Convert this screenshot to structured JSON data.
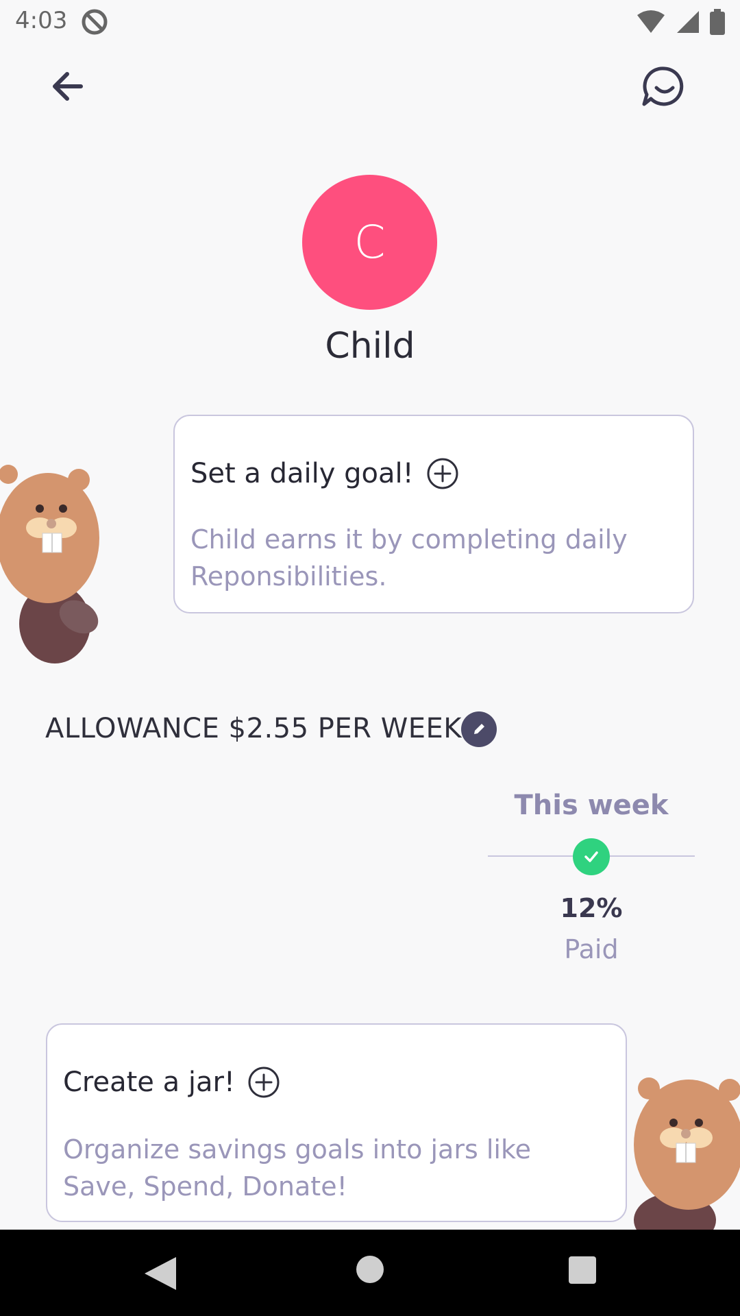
{
  "status_bar": {
    "time": "4:03"
  },
  "profile": {
    "initial": "C",
    "name": "Child",
    "avatar_color": "#fe4f7e"
  },
  "goal_card": {
    "title": "Set a daily goal!",
    "description": "Child earns it by completing daily Reponsibilities."
  },
  "allowance": {
    "label": "ALLOWANCE $2.55 PER WEEK"
  },
  "week_status": {
    "label": "This week",
    "percent": "12%",
    "status": "Paid",
    "accent": "#2fd27f"
  },
  "jar_card": {
    "title": "Create a jar!",
    "description": "Organize savings goals into jars like Save, Spend, Donate!"
  },
  "icons": [
    "back-arrow-icon",
    "chat-smile-icon",
    "plus-circle-icon",
    "pencil-icon",
    "check-icon",
    "beaver-mascot"
  ]
}
